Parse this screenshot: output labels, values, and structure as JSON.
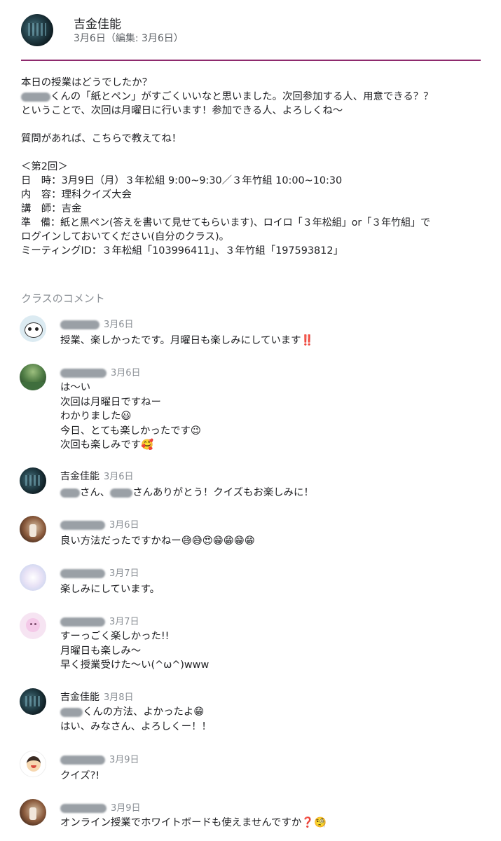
{
  "post": {
    "author": "吉金佳能",
    "date": "3月6日（編集: 3月6日）",
    "lines": {
      "l1": "本日の授業はどうでしたか？",
      "l2": "くんの「紙とペン」がすごくいいなと思いました。次回参加する人、用意できる？？",
      "l3": "ということで、次回は月曜日に行います！参加できる人、よろしくね〜",
      "l4": "質問があれば、こちらで教えてね！",
      "l5": "＜第2回＞",
      "l6": "日　時：3月9日（月）３年松組 9:00~9:30／３年竹組 10:00~10:30",
      "l7": "内　容：理科クイズ大会",
      "l8": "講　師：吉金",
      "l9": "準　備：紙と黒ペン(答えを書いて見せてもらいます)、ロイロ「３年松組」or「３年竹組」で",
      "l10": "ログインしておいてください(自分のクラス)。",
      "l11": "ミーティングID：３年松組「103996411」、３年竹組「197593812」"
    }
  },
  "comments_title": "クラスのコメント",
  "comments": [
    {
      "date": "3月6日",
      "lines": [
        "授業、楽しかったです。月曜日も楽しみにしています‼️"
      ]
    },
    {
      "date": "3月6日",
      "lines": [
        "は〜い",
        "次回は月曜日ですねー",
        "わかりました😃",
        "今日、とても楽しかったです😉",
        "次回も楽しみです🥰"
      ]
    },
    {
      "name": "吉金佳能",
      "date": "3月6日",
      "lines": [
        "さん、",
        "さんありがとう！クイズもお楽しみに！"
      ]
    },
    {
      "date": "3月6日",
      "lines": [
        "良い方法だったですかねー😅😅😍😁😁😁😁"
      ]
    },
    {
      "date": "3月7日",
      "lines": [
        "楽しみにしています。"
      ]
    },
    {
      "date": "3月7日",
      "lines": [
        "すーっごく楽しかった!!",
        "月曜日も楽しみ〜",
        "早く授業受けた〜い(^ω^)www"
      ]
    },
    {
      "name": "吉金佳能",
      "date": "3月8日",
      "lines": [
        "くんの方法、よかったよ😁",
        "はい、みなさん、よろしくー！！"
      ]
    },
    {
      "date": "3月9日",
      "lines": [
        "クイズ?!"
      ]
    },
    {
      "date": "3月9日",
      "lines": [
        "オンライン授業でホワイトボードも使えませんですか❓🧐"
      ]
    }
  ]
}
